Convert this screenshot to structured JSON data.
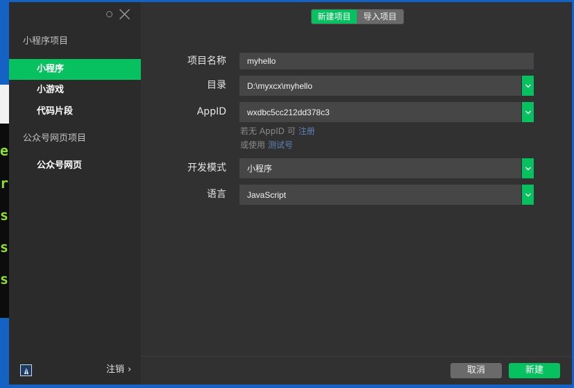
{
  "colors": {
    "accent": "#07c160",
    "link": "#5d83b8",
    "desktop": "#1462c4",
    "terminal_text": "#8ee22b"
  },
  "icons": {
    "settings": "gear-icon",
    "close": "close-icon",
    "dropdown": "chevron-down-icon",
    "avatar": "avatar-icon"
  },
  "background_terminal": {
    "lines": [
      "e",
      "r",
      "s",
      "s",
      "s"
    ]
  },
  "sidebar": {
    "sections": [
      {
        "title": "小程序项目",
        "items": [
          {
            "label": "小程序",
            "active": true
          },
          {
            "label": "小游戏",
            "active": false
          },
          {
            "label": "代码片段",
            "active": false
          }
        ]
      },
      {
        "title": "公众号网页项目",
        "items": [
          {
            "label": "公众号网页",
            "active": false
          }
        ]
      }
    ],
    "logout_label": "注销",
    "logout_chevron": "›"
  },
  "tabs": [
    {
      "label": "新建项目",
      "active": true
    },
    {
      "label": "导入项目",
      "active": false
    }
  ],
  "form": {
    "project_name": {
      "label": "项目名称",
      "value": "myhello"
    },
    "directory": {
      "label": "目录",
      "value": "D:\\myxcx\\myhello"
    },
    "appid": {
      "label": "AppID",
      "value": "wxdbc5cc212dd378c3"
    },
    "appid_hint": {
      "prefix": "若无 AppID 可",
      "link": "注册"
    },
    "test_hint": {
      "prefix": "或使用",
      "link": "测试号"
    },
    "dev_mode": {
      "label": "开发模式",
      "value": "小程序"
    },
    "language": {
      "label": "语言",
      "value": "JavaScript"
    }
  },
  "footer": {
    "cancel_label": "取消",
    "create_label": "新建"
  }
}
